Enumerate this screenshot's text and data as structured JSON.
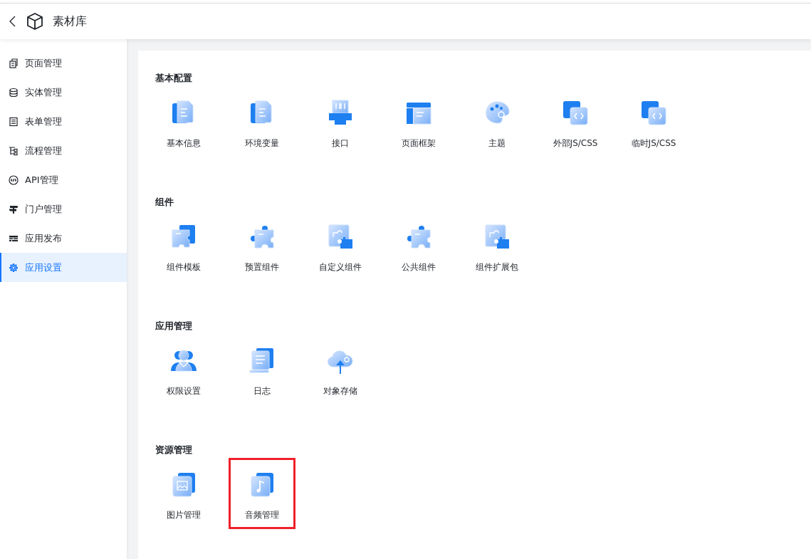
{
  "header": {
    "title": "素材库"
  },
  "sidebar": {
    "items": [
      {
        "label": "页面管理",
        "kind": "pages",
        "selected": false
      },
      {
        "label": "实体管理",
        "kind": "database",
        "selected": false
      },
      {
        "label": "表单管理",
        "kind": "form",
        "selected": false
      },
      {
        "label": "流程管理",
        "kind": "flow",
        "selected": false
      },
      {
        "label": "API管理",
        "kind": "api",
        "selected": false
      },
      {
        "label": "门户管理",
        "kind": "signpost",
        "selected": false
      },
      {
        "label": "应用发布",
        "kind": "publish",
        "selected": false
      },
      {
        "label": "应用设置",
        "kind": "gear",
        "selected": true
      }
    ]
  },
  "sections": [
    {
      "title": "基本配置",
      "tiles": [
        {
          "label": "基本信息",
          "kind": "doc",
          "highlighted": false
        },
        {
          "label": "环境变量",
          "kind": "doc",
          "highlighted": false
        },
        {
          "label": "接口",
          "kind": "plug",
          "highlighted": false
        },
        {
          "label": "页面框架",
          "kind": "layout",
          "highlighted": false
        },
        {
          "label": "主题",
          "kind": "palette",
          "highlighted": false
        },
        {
          "label": "外部JS/CSS",
          "kind": "code",
          "highlighted": false
        },
        {
          "label": "临时JS/CSS",
          "kind": "code",
          "highlighted": false
        }
      ]
    },
    {
      "title": "组件",
      "tiles": [
        {
          "label": "组件模板",
          "kind": "puzzle-stack",
          "highlighted": false
        },
        {
          "label": "预置组件",
          "kind": "puzzle",
          "highlighted": false
        },
        {
          "label": "自定义组件",
          "kind": "puzzle-gear",
          "highlighted": false
        },
        {
          "label": "公共组件",
          "kind": "puzzle",
          "highlighted": false
        },
        {
          "label": "组件扩展包",
          "kind": "puzzle-gear",
          "highlighted": false
        }
      ]
    },
    {
      "title": "应用管理",
      "tiles": [
        {
          "label": "权限设置",
          "kind": "users",
          "highlighted": false
        },
        {
          "label": "日志",
          "kind": "log",
          "highlighted": false
        },
        {
          "label": "对象存储",
          "kind": "cloud",
          "highlighted": false
        }
      ]
    },
    {
      "title": "资源管理",
      "tiles": [
        {
          "label": "图片管理",
          "kind": "image",
          "highlighted": false
        },
        {
          "label": "音频管理",
          "kind": "music",
          "highlighted": true
        }
      ]
    }
  ]
}
